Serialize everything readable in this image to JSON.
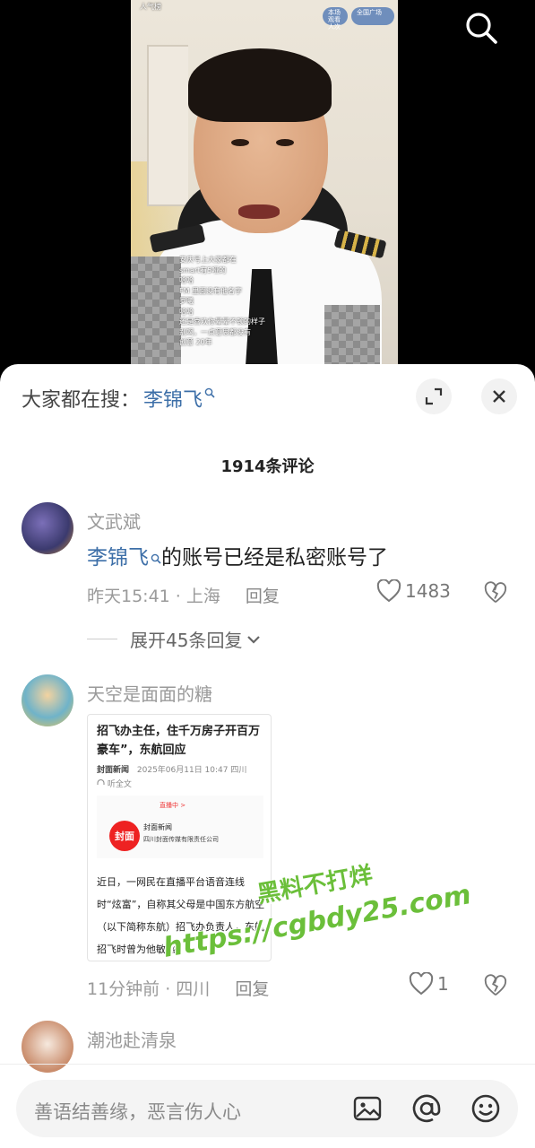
{
  "video": {
    "overlay_top_left": "人气榜",
    "pill_left": "本场观看人次",
    "pill_right": "全国广场",
    "chat": [
      "安庆号上大家都在",
      "smart有5哑的",
      "哈哈",
      "FM 里面没有他名字",
      "罗曦",
      "哈哈",
      "还是喜欢你晕晕不顿的样子",
      "别啊，一点意思都没有",
      "创意 20年"
    ]
  },
  "sheet": {
    "search_prefix": "大家都在搜：",
    "search_keyword": "李锦飞",
    "comment_count": "1914条评论"
  },
  "comments": [
    {
      "user": "文武斌",
      "text_link": "李锦飞",
      "text_rest": "的账号已经是私密账号了",
      "time_location": "昨天15:41 · 上海",
      "reply_label": "回复",
      "likes": "1483",
      "expand_label": "展开45条回复"
    },
    {
      "user": "天空是面面的糖",
      "time_location": "11分钟前 · 四川",
      "reply_label": "回复",
      "likes": "1",
      "card": {
        "title": "招飞办主任，住千万房子开百万豪车”，东航回应",
        "source": "封面新闻",
        "date": "2025年06月11日 10:47 四川",
        "listen": "听全文",
        "live_label": "直播中 >",
        "logo_text": "封面",
        "publisher": "封面新闻",
        "publisher_corp": "四川封面传媒有限责任公司",
        "body": "近日，一网民在直播平台语音连线时“炫富”，自称其父母是中国东方航空（以下简称东航）招飞办负责人，东航招飞时曾为他敏感"
      }
    },
    {
      "user": "潮池赴清泉"
    }
  ],
  "watermark": {
    "line1": "黑料不打烊",
    "line2": "https://cgbdy25.com"
  },
  "input": {
    "placeholder": "善语结善缘，恶言伤人心"
  },
  "colors": {
    "link_blue": "#3d6fa8",
    "watermark_green": "#6bbf3a"
  },
  "icons": [
    "search-icon",
    "keyword-search-icon",
    "expand-icon",
    "close-icon",
    "heart-icon",
    "broken-heart-icon",
    "chevron-down-icon",
    "image-icon",
    "at-icon",
    "emoji-icon",
    "headphone-icon"
  ]
}
